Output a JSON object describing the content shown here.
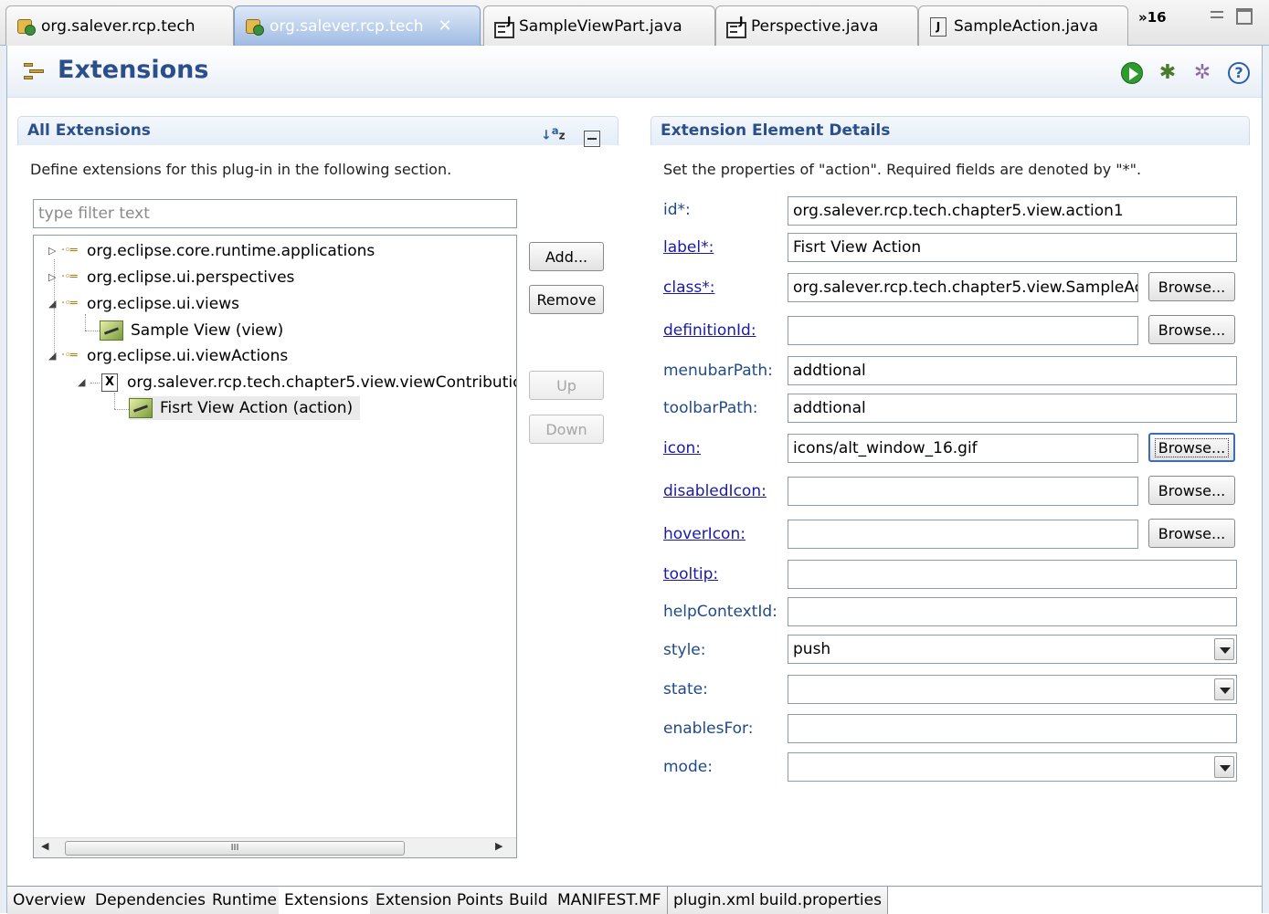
{
  "editor_tabs": [
    {
      "label": "org.salever.rcp.tech",
      "icon": "plugin-icon",
      "active": false
    },
    {
      "label": "org.salever.rcp.tech",
      "icon": "plugin-icon",
      "active": true
    },
    {
      "label": "SampleViewPart.java",
      "icon": "java-editor-icon",
      "active": false
    },
    {
      "label": "Perspective.java",
      "icon": "java-editor-icon",
      "active": false
    },
    {
      "label": "SampleAction.java",
      "icon": "java-file-icon",
      "active": false
    }
  ],
  "tab_overflow": "»16",
  "header": {
    "title": "Extensions",
    "icons": [
      "extensions-icon",
      "run-icon",
      "debug-icon",
      "profile-icon",
      "help-icon"
    ],
    "help_glyph": "?"
  },
  "all_extensions": {
    "title": "All Extensions",
    "description": "Define extensions for this plug-in in the following section.",
    "filter_placeholder": "type filter text",
    "tree": [
      {
        "label": "org.eclipse.core.runtime.applications",
        "expanded": false
      },
      {
        "label": "org.eclipse.ui.perspectives",
        "expanded": false
      },
      {
        "label": "org.eclipse.ui.views",
        "expanded": true
      },
      {
        "label": "Sample View (view)"
      },
      {
        "label": "org.eclipse.ui.viewActions",
        "expanded": true
      },
      {
        "label": "org.salever.rcp.tech.chapter5.view.viewContributic",
        "expanded": true
      },
      {
        "label": "Fisrt View Action (action)",
        "selected": true
      }
    ],
    "scroll_thumb": "III",
    "buttons": {
      "add": "Add...",
      "remove": "Remove",
      "up": "Up",
      "down": "Down"
    }
  },
  "details": {
    "title": "Extension Element Details",
    "description": "Set the properties of \"action\". Required fields are denoted by \"*\".",
    "browse_label": "Browse...",
    "fields": {
      "id": {
        "label": "id*:",
        "value": "org.salever.rcp.tech.chapter5.view.action1"
      },
      "label": {
        "label": "label*:",
        "value": "Fisrt View Action"
      },
      "class": {
        "label": "class*:",
        "value": "org.salever.rcp.tech.chapter5.view.SampleAc"
      },
      "definitionId": {
        "label": "definitionId:",
        "value": ""
      },
      "menubarPath": {
        "label": "menubarPath:",
        "value": "addtional"
      },
      "toolbarPath": {
        "label": "toolbarPath:",
        "value": "addtional"
      },
      "icon": {
        "label": "icon:",
        "value": "icons/alt_window_16.gif"
      },
      "disabledIcon": {
        "label": "disabledIcon:",
        "value": ""
      },
      "hoverIcon": {
        "label": "hoverIcon:",
        "value": ""
      },
      "tooltip": {
        "label": "tooltip:",
        "value": ""
      },
      "helpContextId": {
        "label": "helpContextId:",
        "value": ""
      },
      "style": {
        "label": "style:",
        "value": "push"
      },
      "state": {
        "label": "state:",
        "value": ""
      },
      "enablesFor": {
        "label": "enablesFor:",
        "value": ""
      },
      "mode": {
        "label": "mode:",
        "value": ""
      }
    }
  },
  "bottom_tabs": [
    "Overview",
    "Dependencies",
    "Runtime",
    "Extensions",
    "Extension Points",
    "Build",
    "MANIFEST.MF",
    "plugin.xml",
    "build.properties"
  ],
  "active_bottom_tab": "Extensions",
  "colors": {
    "title_blue": "#2b4f8a",
    "link_blue": "#1a1aa6",
    "active_tab": "#9fbbe3"
  }
}
